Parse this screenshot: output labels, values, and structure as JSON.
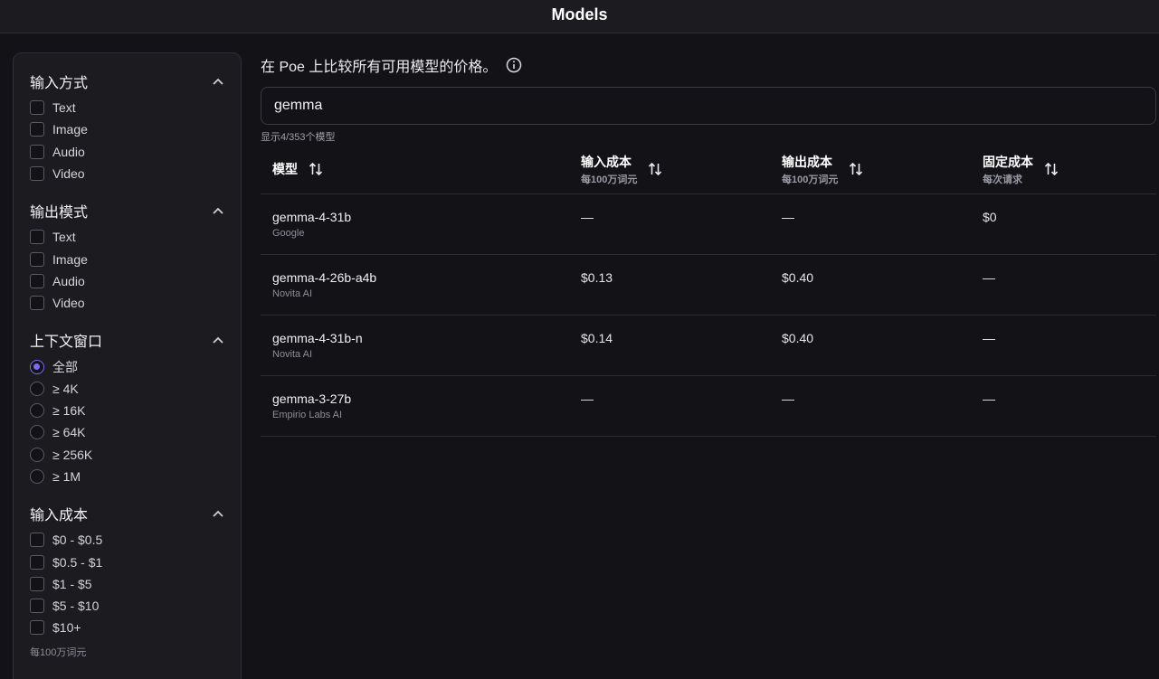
{
  "header": {
    "title": "Models"
  },
  "sidebar": {
    "sections": [
      {
        "title": "输入方式",
        "type": "checkbox",
        "options": [
          "Text",
          "Image",
          "Audio",
          "Video"
        ]
      },
      {
        "title": "输出模式",
        "type": "checkbox",
        "options": [
          "Text",
          "Image",
          "Audio",
          "Video"
        ]
      },
      {
        "title": "上下文窗口",
        "type": "radio",
        "selected": 0,
        "options": [
          "全部",
          "≥ 4K",
          "≥ 16K",
          "≥ 64K",
          "≥ 256K",
          "≥ 1M"
        ]
      },
      {
        "title": "输入成本",
        "type": "checkbox",
        "options": [
          "$0 - $0.5",
          "$0.5 - $1",
          "$1 - $5",
          "$5 - $10",
          "$10+"
        ],
        "note": "每100万词元"
      }
    ]
  },
  "main": {
    "intro": "在 Poe 上比较所有可用模型的价格。",
    "search": {
      "value": "gemma",
      "placeholder": ""
    },
    "count": "显示4/353个模型",
    "table": {
      "headers": [
        {
          "label": "模型",
          "sub": ""
        },
        {
          "label": "输入成本",
          "sub": "每100万词元"
        },
        {
          "label": "输出成本",
          "sub": "每100万词元"
        },
        {
          "label": "固定成本",
          "sub": "每次请求"
        }
      ],
      "rows": [
        {
          "name": "gemma-4-31b",
          "provider": "Google",
          "input": "—",
          "output": "—",
          "fixed": "$0"
        },
        {
          "name": "gemma-4-26b-a4b",
          "provider": "Novita AI",
          "input": "$0.13",
          "output": "$0.40",
          "fixed": "—"
        },
        {
          "name": "gemma-4-31b-n",
          "provider": "Novita AI",
          "input": "$0.14",
          "output": "$0.40",
          "fixed": "—"
        },
        {
          "name": "gemma-3-27b",
          "provider": "Empirio Labs AI",
          "input": "—",
          "output": "—",
          "fixed": "—"
        }
      ]
    }
  },
  "icons": {
    "collapse": "chevron-up-icon",
    "info": "info-icon",
    "sort": "sort-arrows-icon"
  },
  "colors": {
    "accent": "#7c6bf2",
    "background": "#121217",
    "panel": "#1b1b20"
  }
}
